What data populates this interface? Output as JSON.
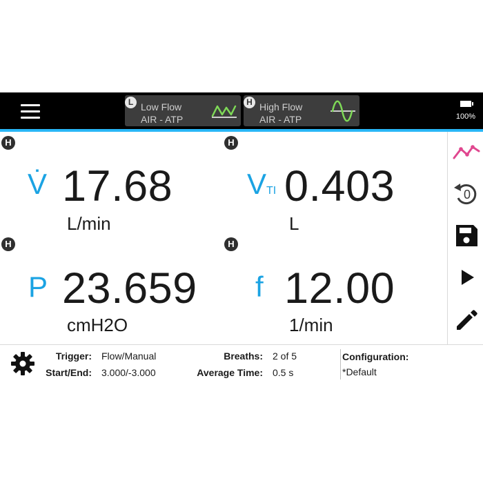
{
  "header": {
    "low_flow": {
      "badge": "L",
      "name": "Low Flow",
      "gas": "AIR - ATP",
      "wave_color": "#7ed957"
    },
    "high_flow": {
      "badge": "H",
      "name": "High Flow",
      "gas": "AIR - ATP",
      "wave_color": "#7ed957"
    },
    "battery": {
      "percent": "100%"
    }
  },
  "panels": [
    {
      "badge": "H",
      "symbol": "V̇",
      "symbol_sub": "",
      "value": "17.68",
      "unit": "L/min"
    },
    {
      "badge": "H",
      "symbol": "V",
      "symbol_sub": "TI",
      "value": "0.403",
      "unit": "L"
    },
    {
      "badge": "H",
      "symbol": "P",
      "symbol_sub": "",
      "value": "23.659",
      "unit": "cmH2O"
    },
    {
      "badge": "H",
      "symbol": "f",
      "symbol_sub": "",
      "value": "12.00",
      "unit": "1/min"
    }
  ],
  "sidebar": {
    "icons": [
      "trend-icon",
      "zero-reset-icon",
      "save-icon",
      "play-icon",
      "edit-icon"
    ],
    "trend_color": "#e0478f"
  },
  "status": {
    "trigger_label": "Trigger:",
    "trigger_value": "Flow/Manual",
    "start_end_label": "Start/End:",
    "start_end_value": "3.000/-3.000",
    "breaths_label": "Breaths:",
    "breaths_value": "2 of 5",
    "avg_time_label": "Average Time:",
    "avg_time_value": "0.5 s",
    "config_label": "Configuration:",
    "config_value": "*Default"
  },
  "colors": {
    "accent": "#29b6f6",
    "symbol": "#1ba3e3"
  }
}
